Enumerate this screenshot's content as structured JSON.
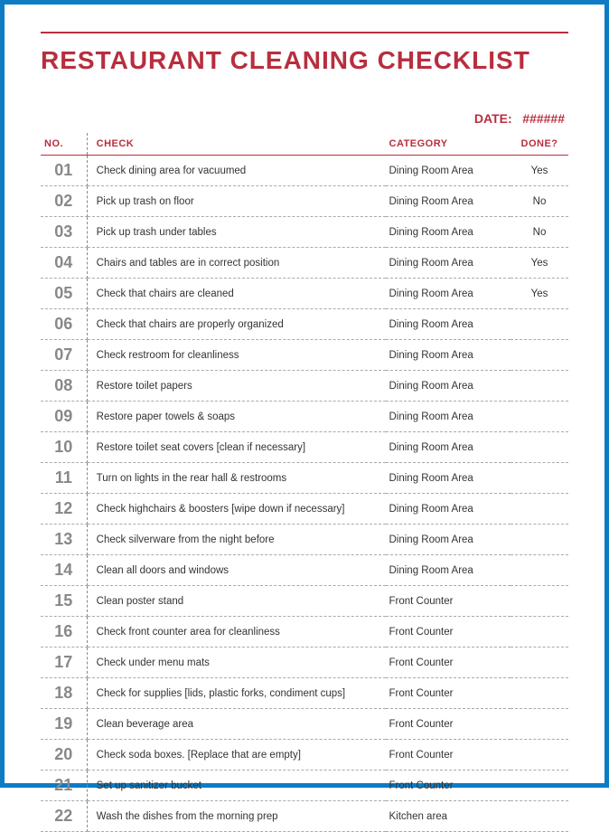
{
  "title": "RESTAURANT CLEANING CHECKLIST",
  "date_label": "DATE:",
  "date_value": "######",
  "headers": {
    "no": "NO.",
    "check": "CHECK",
    "category": "CATEGORY",
    "done": "DONE?"
  },
  "rows": [
    {
      "no": "01",
      "check": "Check dining area for vacuumed",
      "category": "Dining Room Area",
      "done": "Yes"
    },
    {
      "no": "02",
      "check": "Pick up trash on floor",
      "category": "Dining Room Area",
      "done": "No"
    },
    {
      "no": "03",
      "check": "Pick up trash under tables",
      "category": "Dining Room Area",
      "done": "No"
    },
    {
      "no": "04",
      "check": "Chairs and tables are in correct position",
      "category": "Dining Room Area",
      "done": "Yes"
    },
    {
      "no": "05",
      "check": "Check that chairs are cleaned",
      "category": "Dining Room Area",
      "done": "Yes"
    },
    {
      "no": "06",
      "check": "Check that chairs are properly organized",
      "category": "Dining Room Area",
      "done": ""
    },
    {
      "no": "07",
      "check": "Check restroom for cleanliness",
      "category": "Dining Room Area",
      "done": ""
    },
    {
      "no": "08",
      "check": "Restore toilet papers",
      "category": "Dining Room Area",
      "done": ""
    },
    {
      "no": "09",
      "check": "Restore paper towels & soaps",
      "category": "Dining Room Area",
      "done": ""
    },
    {
      "no": "10",
      "check": "Restore toilet seat covers [clean if necessary]",
      "category": "Dining Room Area",
      "done": ""
    },
    {
      "no": "11",
      "check": "Turn on lights in the rear hall & restrooms",
      "category": "Dining Room Area",
      "done": ""
    },
    {
      "no": "12",
      "check": "Check highchairs & boosters [wipe down if necessary]",
      "category": "Dining Room Area",
      "done": ""
    },
    {
      "no": "13",
      "check": "Check silverware from the night before",
      "category": "Dining Room Area",
      "done": ""
    },
    {
      "no": "14",
      "check": "Clean all doors and windows",
      "category": "Dining Room Area",
      "done": ""
    },
    {
      "no": "15",
      "check": "Clean poster stand",
      "category": "Front Counter",
      "done": ""
    },
    {
      "no": "16",
      "check": "Check front counter area for cleanliness",
      "category": "Front Counter",
      "done": ""
    },
    {
      "no": "17",
      "check": "Check under menu mats",
      "category": "Front Counter",
      "done": ""
    },
    {
      "no": "18",
      "check": "Check for supplies [lids, plastic forks, condiment cups]",
      "category": "Front Counter",
      "done": ""
    },
    {
      "no": "19",
      "check": "Clean beverage area",
      "category": "Front Counter",
      "done": ""
    },
    {
      "no": "20",
      "check": "Check soda boxes. [Replace that are empty]",
      "category": "Front Counter",
      "done": ""
    },
    {
      "no": "21",
      "check": "Set up sanitizer bucket",
      "category": "Front Counter",
      "done": ""
    },
    {
      "no": "22",
      "check": "Wash the dishes from the morning prep",
      "category": "Kitchen area",
      "done": ""
    }
  ]
}
